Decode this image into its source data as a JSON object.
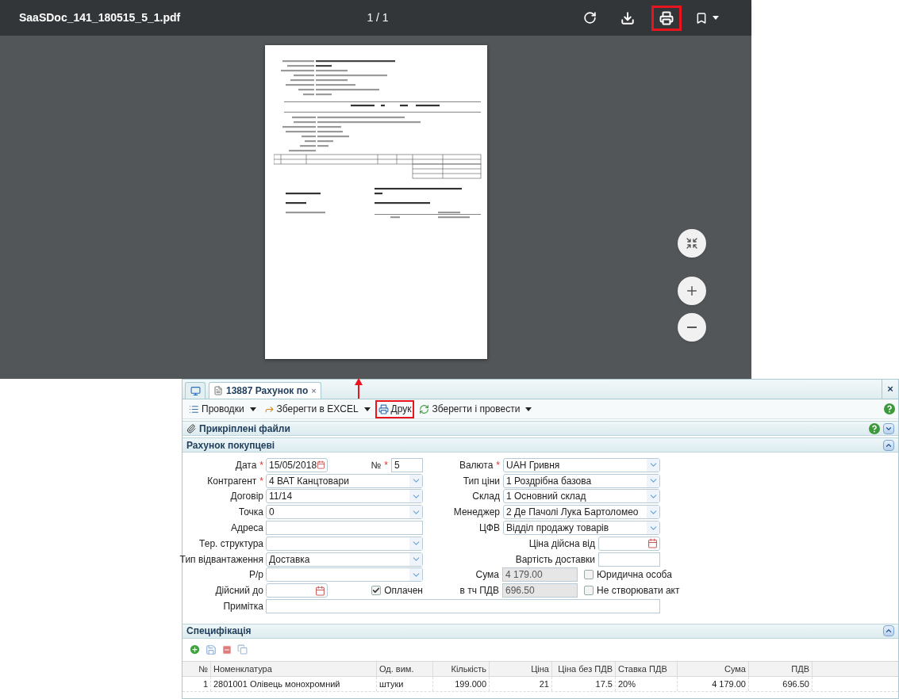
{
  "pdf_viewer": {
    "file_name": "SaaSDoc_141_180515_5_1.pdf",
    "page_counter": "1 / 1",
    "print_highlighted": true
  },
  "app": {
    "tabs": [
      {
        "kind": "home",
        "selected": false
      },
      {
        "kind": "document",
        "label": "13887 Рахунок по",
        "close": "×",
        "selected": true
      }
    ],
    "panel_close": "×",
    "toolbar": [
      {
        "kind": "postings",
        "label": "Проводки",
        "dropdown": true,
        "highlighted": false
      },
      {
        "kind": "excel",
        "label": "Зберегти в EXCEL",
        "dropdown": true,
        "highlighted": false
      },
      {
        "kind": "print",
        "label": "Друк",
        "dropdown": false,
        "highlighted": true
      },
      {
        "kind": "save_post",
        "label": "Зберегти і провести",
        "dropdown": true,
        "highlighted": false
      }
    ],
    "attachments": {
      "title": "Прикріплені файли",
      "expanded": false
    },
    "invoice": {
      "title": "Рахунок покупцеві",
      "expanded": true,
      "rows": [
        {
          "left": {
            "label": "Дата",
            "marker": "*",
            "kind": "date",
            "value": "15/05/2018"
          },
          "middle": {
            "label": "№",
            "marker": "*",
            "kind": "number",
            "value": "5"
          },
          "right": {
            "label": "Валюта",
            "marker": "*",
            "kind": "select",
            "value": "UAH Гривня"
          }
        },
        {
          "left": {
            "label": "Контрагент",
            "marker": "*",
            "kind": "select",
            "value": "4 ВАТ Канцтовари"
          },
          "right": {
            "label": "Тип ціни",
            "kind": "select",
            "value": "1 Роздрібна базова"
          }
        },
        {
          "left": {
            "label": "Договір",
            "kind": "select",
            "value": "11/14"
          },
          "right": {
            "label": "Склад",
            "kind": "select",
            "value": "1 Основний склад"
          }
        },
        {
          "left": {
            "label": "Точка",
            "kind": "select",
            "value": "0"
          },
          "right": {
            "label": "Менеджер",
            "kind": "select",
            "value": "2 Де Пачолі Лука Бартоломео"
          }
        },
        {
          "left": {
            "label": "Адреса",
            "kind": "text"
          },
          "right": {
            "label": "ЦФВ",
            "kind": "select",
            "value": "Відділ продажу товарів"
          }
        },
        {
          "left": {
            "label": "Тер. структура",
            "kind": "select"
          },
          "right": {
            "label": "Ціна дійсна від",
            "kind": "date"
          }
        },
        {
          "left": {
            "label": "Тип відвантаження",
            "kind": "select",
            "value": "Доставка"
          },
          "right": {
            "label": "Вартість доставки",
            "kind": "short_text"
          }
        },
        {
          "left": {
            "label": "Р/р",
            "kind": "select"
          },
          "right": {
            "label": "Сума",
            "kind": "readonly",
            "value": "4 179.00"
          },
          "check": {
            "label": "Юридична особа",
            "checked": false
          }
        },
        {
          "left": {
            "label": "Дійсний до",
            "kind": "date"
          },
          "middle": {
            "label": "Оплачен",
            "kind": "checkbox",
            "checked": true
          },
          "right": {
            "label": "в тч ПДВ",
            "kind": "readonly",
            "value": "696.50"
          },
          "check": {
            "label": "Не створювати акт",
            "checked": false
          }
        },
        {
          "left": {
            "label": "Примітка",
            "kind": "note"
          }
        }
      ]
    },
    "specification": {
      "title": "Специфікація",
      "expanded": true,
      "columns": [
        {
          "label": "№",
          "numeric": true
        },
        {
          "label": "Номенклатура",
          "numeric": false
        },
        {
          "label": "Од. вим.",
          "numeric": false
        },
        {
          "label": "Кількість",
          "numeric": true
        },
        {
          "label": "Ціна",
          "numeric": true
        },
        {
          "label": "Ціна без ПДВ",
          "numeric": true
        },
        {
          "label": "Ставка ПДВ",
          "numeric": false
        },
        {
          "label": "Сума",
          "numeric": true
        },
        {
          "label": "ПДВ",
          "numeric": true
        }
      ],
      "rows": [
        [
          "1",
          "2801001 Олівець монохромний",
          "штуки",
          "199.000",
          "21",
          "17.5",
          "20%",
          "4 179.00",
          "696.50"
        ]
      ]
    }
  }
}
